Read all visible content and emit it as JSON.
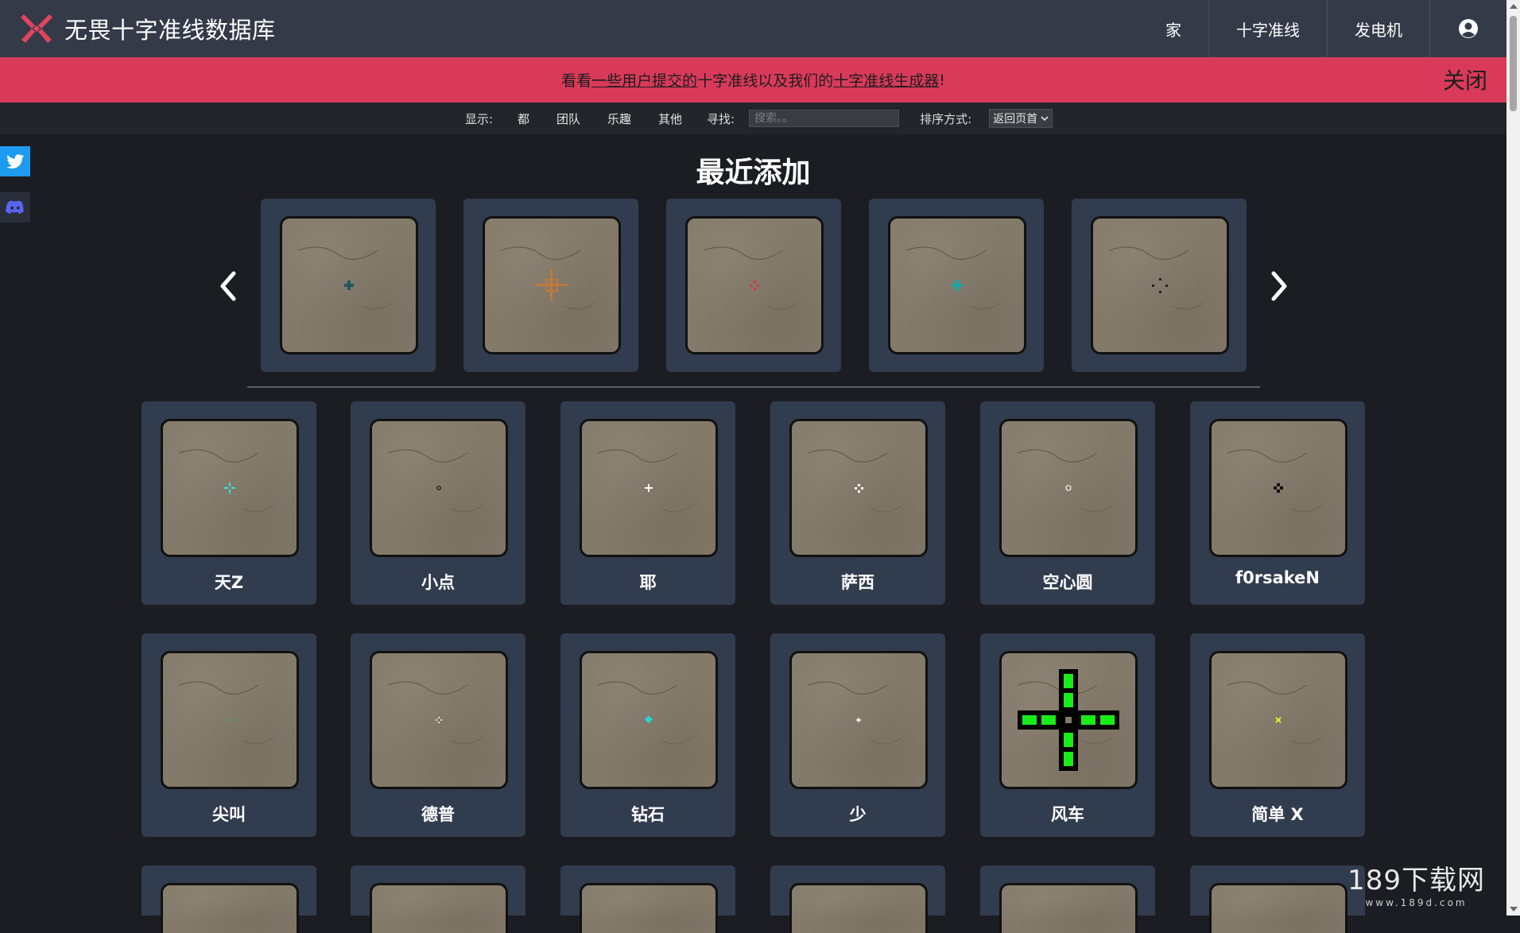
{
  "header": {
    "title": "无畏十字准线数据库",
    "nav": [
      "家",
      "十字准线",
      "发电机"
    ],
    "user_icon": "user-circle-icon"
  },
  "banner": {
    "pre": "看看",
    "link1": "一些用户提交的",
    "mid": "十字准线以及我们的",
    "link2": "十字准线生成器",
    "post": "!",
    "close": "关闭",
    "color": "#d93a5a"
  },
  "filters": {
    "show_label": "显示:",
    "options": [
      "都",
      "团队",
      "乐趣",
      "其他"
    ],
    "search_label": "寻找:",
    "search_placeholder": "搜索。。",
    "sort_label": "排序方式:",
    "sort_value": "返回页首"
  },
  "social": {
    "twitter": "twitter-icon",
    "discord": "discord-icon"
  },
  "recent": {
    "title": "最近添加"
  },
  "cards": [
    {
      "name": "天Z"
    },
    {
      "name": "小点"
    },
    {
      "name": "耶"
    },
    {
      "name": "萨西"
    },
    {
      "name": "空心圆"
    },
    {
      "name": "f0rsakeN"
    },
    {
      "name": "尖叫"
    },
    {
      "name": "德普"
    },
    {
      "name": "钻石"
    },
    {
      "name": "少"
    },
    {
      "name": "风车"
    },
    {
      "name": "简单 X"
    }
  ],
  "watermark": {
    "main": "189下载网",
    "sub": "www.189d.com"
  }
}
